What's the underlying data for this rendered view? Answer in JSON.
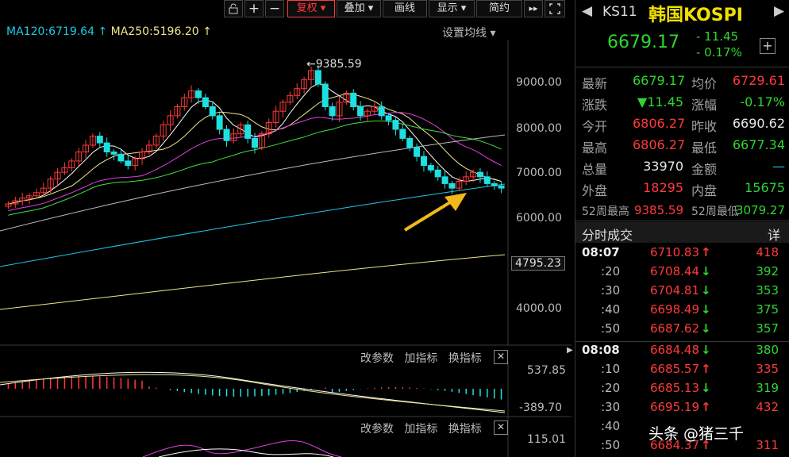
{
  "toolbar": {
    "buttons": [
      {
        "label": "复权",
        "active": true
      },
      {
        "label": "叠加"
      },
      {
        "label": "画线"
      },
      {
        "label": "显示"
      },
      {
        "label": "简约"
      }
    ]
  },
  "ma_legend": {
    "ma120": "MA120:6719.64",
    "ma250": "MA250:5196.20",
    "settings": "设置均线"
  },
  "price_axis": {
    "ticks": [
      "9000.00",
      "8000.00",
      "7000.00",
      "6000.00",
      "4000.00"
    ],
    "current_box": "4795.23",
    "high_marker": "9385.59"
  },
  "sub_panels": {
    "macd": {
      "buttons": [
        "改参数",
        "加指标",
        "换指标"
      ],
      "top_label": "537.85",
      "bottom_label": "-389.70"
    },
    "third": {
      "buttons": [
        "改参数",
        "加指标",
        "换指标"
      ],
      "top_label": "115.01"
    }
  },
  "header": {
    "code": "KS11",
    "name": "韩国KOSPI",
    "price": "6679.17",
    "change": "- 11.45",
    "change_pct": "- 0.17%"
  },
  "quote": {
    "rows": [
      {
        "l1": "最新",
        "v1": "6679.17",
        "c1": "green",
        "l2": "均价",
        "v2": "6729.61",
        "c2": "red"
      },
      {
        "l1": "涨跌",
        "v1": "▼11.45",
        "c1": "green",
        "l2": "涨幅",
        "v2": "-0.17%",
        "c2": "green"
      },
      {
        "l1": "今开",
        "v1": "6806.27",
        "c1": "red",
        "l2": "昨收",
        "v2": "6690.62",
        "c2": "white"
      },
      {
        "l1": "最高",
        "v1": "6806.27",
        "c1": "red",
        "l2": "最低",
        "v2": "6677.34",
        "c2": "green"
      },
      {
        "l1": "总量",
        "v1": "33970",
        "c1": "white",
        "l2": "金额",
        "v2": "—",
        "c2": "cyan"
      },
      {
        "l1": "外盘",
        "v1": "18295",
        "c1": "red",
        "l2": "内盘",
        "v2": "15675",
        "c2": "green"
      }
    ],
    "week52": {
      "l1": "52周最高",
      "v1": "9385.59",
      "l2": "52周最低",
      "v2": "3079.27"
    }
  },
  "ticks_panel": {
    "title": "分时成交",
    "detail": "详",
    "rows": [
      {
        "time": "08:07",
        "price": "6710.83",
        "dir": "up",
        "vol": "418"
      },
      {
        "time": ":20",
        "price": "6708.44",
        "dir": "down",
        "vol": "392"
      },
      {
        "time": ":30",
        "price": "6704.81",
        "dir": "down",
        "vol": "353"
      },
      {
        "time": ":40",
        "price": "6698.49",
        "dir": "down",
        "vol": "375"
      },
      {
        "time": ":50",
        "price": "6687.62",
        "dir": "down",
        "vol": "357"
      },
      {
        "time": "08:08",
        "price": "6684.48",
        "dir": "down",
        "vol": "380"
      },
      {
        "time": ":10",
        "price": "6685.57",
        "dir": "up",
        "vol": "335"
      },
      {
        "time": ":20",
        "price": "6685.13",
        "dir": "down",
        "vol": "319"
      },
      {
        "time": ":30",
        "price": "6695.19",
        "dir": "up",
        "vol": "432"
      },
      {
        "time": ":40",
        "price": "",
        "dir": "",
        "vol": ""
      },
      {
        "time": ":50",
        "price": "6684.37",
        "dir": "up",
        "vol": "311"
      }
    ]
  },
  "watermark": "头条 @猪三千"
}
